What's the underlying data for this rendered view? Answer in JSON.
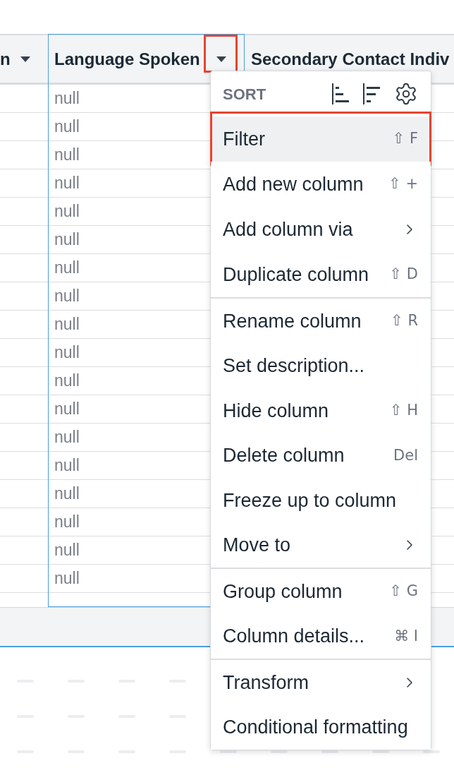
{
  "table": {
    "columns": [
      {
        "label": "n",
        "selected": false,
        "menu_button": true,
        "annotated": false
      },
      {
        "label": "Language Spoken",
        "selected": true,
        "menu_button": true,
        "annotated": true
      },
      {
        "label": "Secondary Contact Indiv",
        "selected": false,
        "menu_button": false
      }
    ],
    "rows": [
      {
        "language_spoken": "null"
      },
      {
        "language_spoken": "null"
      },
      {
        "language_spoken": "null"
      },
      {
        "language_spoken": "null"
      },
      {
        "language_spoken": "null"
      },
      {
        "language_spoken": "null"
      },
      {
        "language_spoken": "null"
      },
      {
        "language_spoken": "null"
      },
      {
        "language_spoken": "null"
      },
      {
        "language_spoken": "null"
      },
      {
        "language_spoken": "null"
      },
      {
        "language_spoken": "null"
      },
      {
        "language_spoken": "null"
      },
      {
        "language_spoken": "null"
      },
      {
        "language_spoken": "null"
      },
      {
        "language_spoken": "null"
      },
      {
        "language_spoken": "null"
      },
      {
        "language_spoken": "null"
      }
    ]
  },
  "column_menu": {
    "sort_label": "SORT",
    "sections": [
      {
        "items": [
          {
            "label": "Filter",
            "kind": "shortcut",
            "shortcut": "⇧ F",
            "selected": true,
            "annotated": true
          },
          {
            "label": "Add new column",
            "kind": "shortcut",
            "shortcut": "⇧ +",
            "selected": false,
            "annotated": false
          },
          {
            "label": "Add column via",
            "kind": "submenu",
            "selected": false,
            "annotated": false
          },
          {
            "label": "Duplicate column",
            "kind": "shortcut",
            "shortcut": "⇧ D",
            "selected": false,
            "annotated": false
          }
        ]
      },
      {
        "items": [
          {
            "label": "Rename column",
            "kind": "shortcut",
            "shortcut": "⇧ R",
            "selected": false,
            "annotated": false
          },
          {
            "label": "Set description...",
            "kind": "plain",
            "selected": false,
            "annotated": false
          },
          {
            "label": "Hide column",
            "kind": "shortcut",
            "shortcut": "⇧ H",
            "selected": false,
            "annotated": false
          },
          {
            "label": "Delete column",
            "kind": "shortcut",
            "shortcut": "Del",
            "selected": false,
            "annotated": false
          },
          {
            "label": "Freeze up to column",
            "kind": "plain",
            "selected": false,
            "annotated": false
          },
          {
            "label": "Move to",
            "kind": "submenu",
            "selected": false,
            "annotated": false
          }
        ]
      },
      {
        "items": [
          {
            "label": "Group column",
            "kind": "shortcut",
            "shortcut": "⇧ G",
            "selected": false,
            "annotated": false
          },
          {
            "label": "Column details...",
            "kind": "shortcut",
            "shortcut": "⌘ I",
            "selected": false,
            "annotated": false
          }
        ]
      },
      {
        "items": [
          {
            "label": "Transform",
            "kind": "submenu",
            "selected": false,
            "annotated": false
          },
          {
            "label": "Conditional formatting",
            "kind": "plain",
            "selected": false,
            "annotated": false
          }
        ]
      }
    ]
  }
}
